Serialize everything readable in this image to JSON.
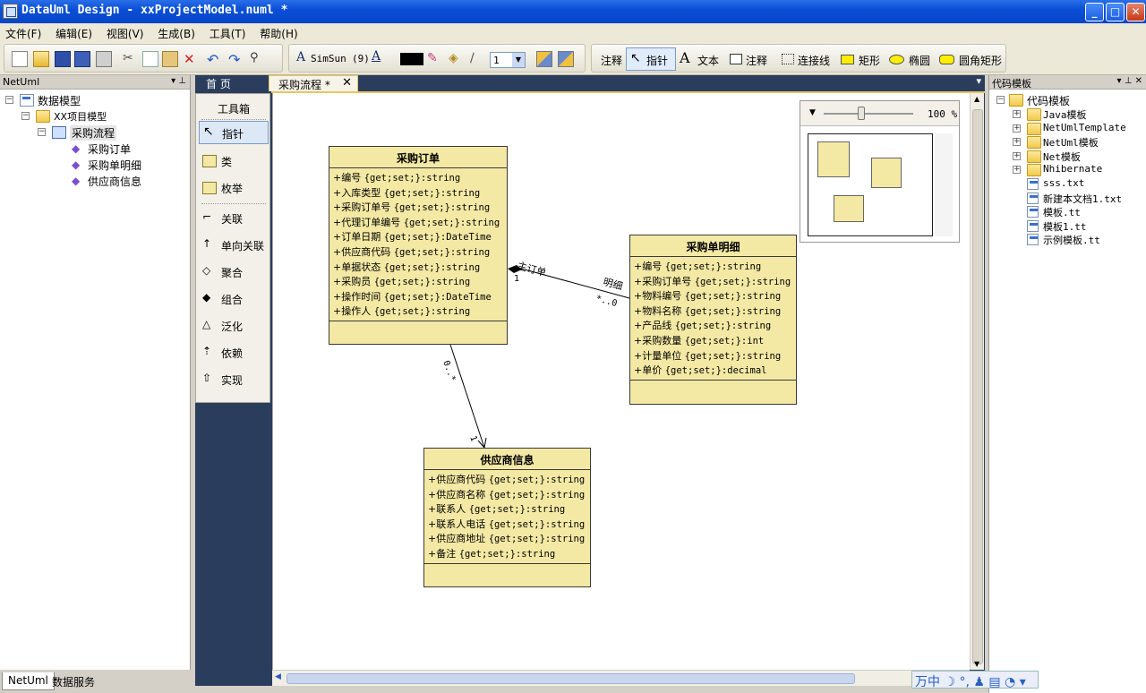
{
  "window": {
    "title": "DataUml Design - xxProjectModel.numl *",
    "minimize": "_",
    "maximize": "□",
    "close": "✕"
  },
  "menu": [
    "文件(F)",
    "编辑(E)",
    "视图(V)",
    "生成(B)",
    "工具(T)",
    "帮助(H)"
  ],
  "toolbar": {
    "font_name": "SimSun",
    "font_size": "(9)",
    "line_width": "1",
    "tools": [
      "注释",
      "指针",
      "文本",
      "注释",
      "连接线",
      "矩形",
      "椭圆",
      "圆角矩形"
    ]
  },
  "left_panel": {
    "title": "NetUml",
    "tree": {
      "root": "数据模型",
      "project": "XX项目模型",
      "flow": "采购流程",
      "items": [
        "采购订单",
        "采购单明细",
        "供应商信息"
      ]
    },
    "tabs": [
      "NetUml",
      "数据服务"
    ]
  },
  "doc_tabs": [
    "首 页",
    "采购流程 *"
  ],
  "toolbox": {
    "title": "工具箱",
    "items": [
      "指针",
      "类",
      "枚举",
      "关联",
      "单向关联",
      "聚合",
      "组合",
      "泛化",
      "依赖",
      "实现"
    ]
  },
  "classes": {
    "purchase_order": {
      "name": "采购订单",
      "attrs": [
        {
          "n": "+编号",
          "t": "{get;set;}:string"
        },
        {
          "n": "+入库类型",
          "t": "{get;set;}:string"
        },
        {
          "n": "+采购订单号",
          "t": "{get;set;}:string"
        },
        {
          "n": "+代理订单编号",
          "t": "{get;set;}:string"
        },
        {
          "n": "+订单日期",
          "t": "{get;set;}:DateTime"
        },
        {
          "n": "+供应商代码",
          "t": "{get;set;}:string"
        },
        {
          "n": "+单据状态",
          "t": "{get;set;}:string"
        },
        {
          "n": "+采购员",
          "t": "{get;set;}:string"
        },
        {
          "n": "+操作时间",
          "t": "{get;set;}:DateTime"
        },
        {
          "n": "+操作人",
          "t": "{get;set;}:string"
        }
      ]
    },
    "order_detail": {
      "name": "采购单明细",
      "attrs": [
        {
          "n": "+编号",
          "t": "{get;set;}:string"
        },
        {
          "n": "+采购订单号",
          "t": "{get;set;}:string"
        },
        {
          "n": "+物料编号",
          "t": "{get;set;}:string"
        },
        {
          "n": "+物料名称",
          "t": "{get;set;}:string"
        },
        {
          "n": "+产品线",
          "t": "{get;set;}:string"
        },
        {
          "n": "+采购数量",
          "t": "{get;set;}:int"
        },
        {
          "n": "+计量单位",
          "t": "{get;set;}:string"
        },
        {
          "n": "+单价",
          "t": "{get;set;}:decimal"
        }
      ]
    },
    "supplier": {
      "name": "供应商信息",
      "attrs": [
        {
          "n": "+供应商代码",
          "t": "{get;set;}:string"
        },
        {
          "n": "+供应商名称",
          "t": "{get;set;}:string"
        },
        {
          "n": "+联系人",
          "t": "{get;set;}:string"
        },
        {
          "n": "+联系人电话",
          "t": "{get;set;}:string"
        },
        {
          "n": "+供应商地址",
          "t": "{get;set;}:string"
        },
        {
          "n": "+备注",
          "t": "{get;set;}:string"
        }
      ]
    }
  },
  "relations": {
    "composition": {
      "role_a": "主订单",
      "mult_a": "1",
      "role_b": "明细",
      "mult_b": "*..0"
    },
    "association": {
      "mult_a": "0..*",
      "mult_b": "1"
    }
  },
  "minimap": {
    "zoom": "100 %"
  },
  "right_panel": {
    "title": "代码模板",
    "root": "代码模板",
    "folders": [
      "Java模板",
      "NetUmlTemplate",
      "NetUml模板",
      "Net模板",
      "Nhibernate"
    ],
    "files": [
      "sss.txt",
      "新建本文档1.txt",
      "模板.tt",
      "模板1.tt",
      "示例模板.tt"
    ]
  },
  "status": {
    "ime": "万中 ☽ °, ♟ ▤ ◔ ▾"
  }
}
